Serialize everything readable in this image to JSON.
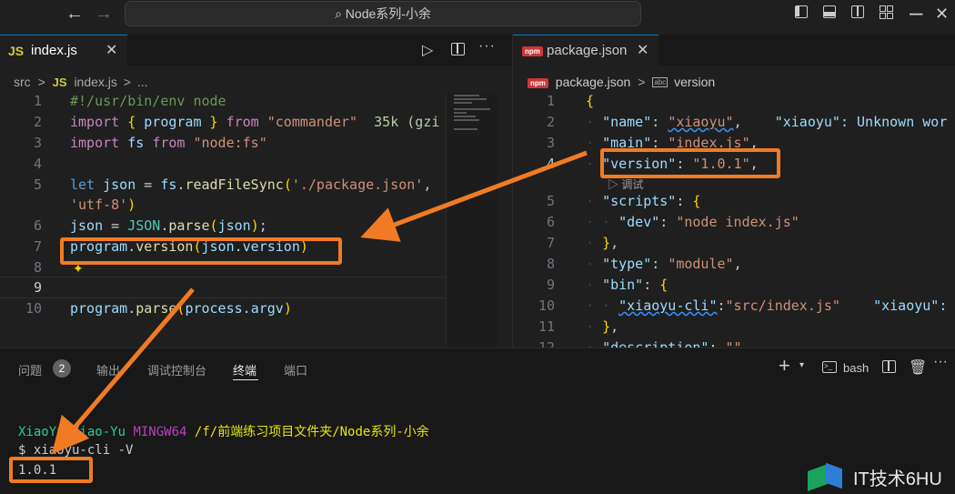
{
  "titlebar": {
    "search_text": "Node系列-小余",
    "back_icon": "arrow-left-icon",
    "forward_icon": "arrow-right-icon"
  },
  "left_editor": {
    "tab_icon_text": "JS",
    "tab_label": "index.js",
    "breadcrumb": {
      "folder": "src",
      "sep1": ">",
      "icon_text": "JS",
      "file": "index.js",
      "sep2": ">",
      "more": "..."
    },
    "line_numbers": [
      "1",
      "2",
      "3",
      "4",
      "5",
      "",
      "6",
      "7",
      "8",
      "9",
      "10"
    ],
    "inline_hint": "35k (gzi"
  },
  "right_editor": {
    "tab_icon_text": "npm",
    "tab_label": "package.json",
    "breadcrumb": {
      "icon_text": "npm",
      "file": "package.json",
      "sep": ">",
      "item_icon": "abc",
      "item": "version"
    },
    "line_numbers": [
      "1",
      "2",
      "3",
      "4",
      "",
      "5",
      "6",
      "7",
      "8",
      "9",
      "10",
      "11",
      "12"
    ],
    "codelens": "调试",
    "ghost_1": "\"xiaoyu\": Unknown wor",
    "ghost_2": "\"xiaoyu\":"
  },
  "panel": {
    "tabs": [
      "问题",
      "输出",
      "调试控制台",
      "终端",
      "端口"
    ],
    "problems_count": "2",
    "active_tab": "终端",
    "shell_label": "bash",
    "prompt_user": "XiaoYu@Xiao-Yu",
    "prompt_env": "MINGW64",
    "prompt_path": "/f/前端练习项目文件夹/Node系列-小余",
    "command": "$ xiaoyu-cli -V",
    "output": "1.0.1"
  },
  "watermark": {
    "text": "IT技术6HU"
  },
  "colors": {
    "accent": "#0078d4",
    "highlight": "#f07b24",
    "prompt_user": "#23d18b",
    "prompt_env": "#bc3fbc",
    "prompt_path": "#e5e510"
  }
}
